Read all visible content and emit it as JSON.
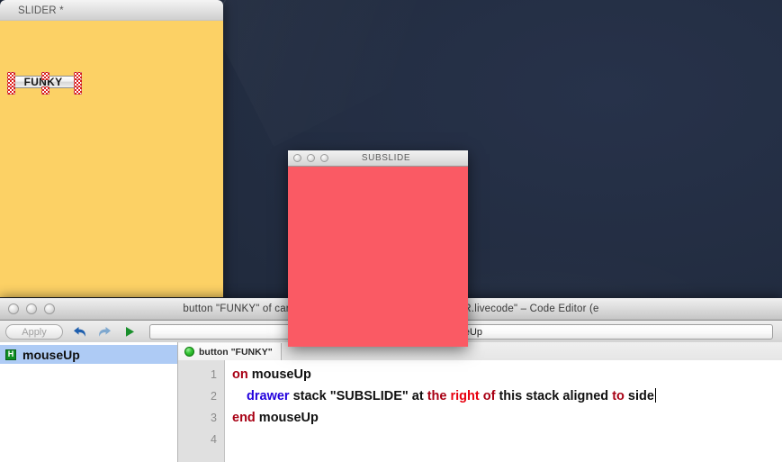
{
  "desktop": {
    "background_color": "#212b3e"
  },
  "slider_window": {
    "title": "SLIDER *",
    "card_color": "#fcd165",
    "button": {
      "label": "FUNKY",
      "selected": true,
      "handle_color": "#e02020"
    }
  },
  "subslide_window": {
    "title": "SUBSLIDE",
    "card_color": "#fa5a64",
    "traffic_lights": [
      "close",
      "minimize",
      "zoom"
    ]
  },
  "editor_window": {
    "title": "button \"FUNKY\" of card id 100                          esktop/Hax 2 Feb 23/SLIDER.livecode\" – Code Editor (e",
    "traffic_lights": [
      "close",
      "minimize",
      "zoom"
    ],
    "toolbar": {
      "apply_label": "Apply",
      "undo_icon": "undo-arrow-icon",
      "redo_icon": "redo-arrow-icon",
      "run_icon": "play-triangle-icon",
      "handler_field_value": "mouseUp"
    },
    "handler_list": [
      {
        "icon": "H",
        "label": "mouseUp",
        "selected": true
      }
    ],
    "tabs": [
      {
        "icon": "green-dot-icon",
        "label": "button \"FUNKY\"",
        "active": true
      }
    ],
    "code": {
      "line_numbers": [
        "1",
        "2",
        "3",
        "4"
      ],
      "lines": [
        {
          "number": "1",
          "indent": 0,
          "tokens": [
            {
              "text": "on",
              "style": "kw-dark-red"
            },
            {
              "text": " mouseUp",
              "style": "plain"
            }
          ]
        },
        {
          "number": "2",
          "indent": 1,
          "tokens": [
            {
              "text": "drawer",
              "style": "kw-blue"
            },
            {
              "text": " stack \"SUBSLIDE\" at ",
              "style": "plain"
            },
            {
              "text": "the ",
              "style": "kw-dark-red"
            },
            {
              "text": "right",
              "style": "kw-red"
            },
            {
              "text": " of",
              "style": "kw-dark-red"
            },
            {
              "text": " this stack aligned ",
              "style": "plain"
            },
            {
              "text": "to",
              "style": "kw-dark-red"
            },
            {
              "text": " side",
              "style": "plain"
            }
          ],
          "caret_at_end": true
        },
        {
          "number": "3",
          "indent": 0,
          "tokens": [
            {
              "text": "end",
              "style": "kw-dark-red"
            },
            {
              "text": " mouseUp",
              "style": "plain"
            }
          ]
        },
        {
          "number": "4",
          "indent": 0,
          "tokens": []
        }
      ]
    }
  }
}
